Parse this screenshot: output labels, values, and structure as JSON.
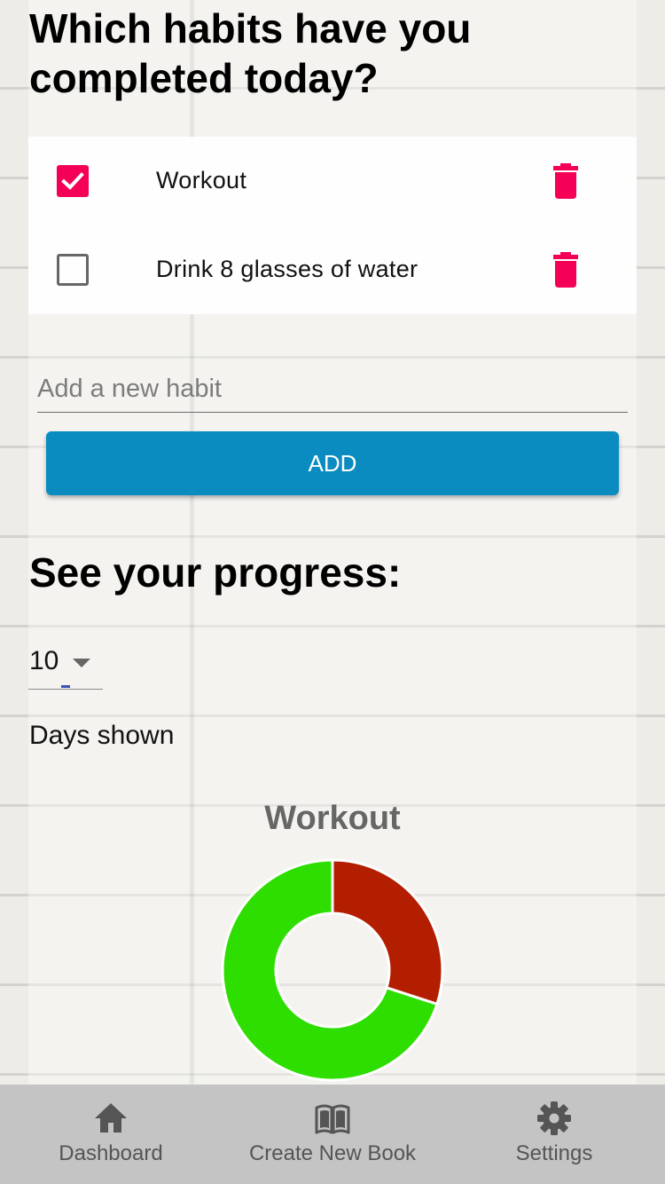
{
  "header": {
    "title": "Which habits have you completed today?"
  },
  "habits": [
    {
      "label": "Workout",
      "completed": true
    },
    {
      "label": "Drink 8 glasses of water",
      "completed": false
    }
  ],
  "new_habit": {
    "placeholder": "Add a new habit",
    "value": "",
    "add_label": "ADD"
  },
  "progress": {
    "title": "See your progress:",
    "days_value": "10",
    "days_caption": "Days shown"
  },
  "chart_data": {
    "type": "pie",
    "title": "Workout",
    "donut": true,
    "slices": [
      {
        "value": 30,
        "color": "#b31e00"
      },
      {
        "value": 70,
        "color": "#2ede00"
      }
    ]
  },
  "colors": {
    "accent": "#f50057",
    "primary_button": "#0a8cc0",
    "nav_background": "#c4c4c4"
  },
  "nav": {
    "items": [
      {
        "label": "Dashboard",
        "icon": "home-icon"
      },
      {
        "label": "Create New Book",
        "icon": "book-icon"
      },
      {
        "label": "Settings",
        "icon": "gear-icon"
      }
    ]
  }
}
